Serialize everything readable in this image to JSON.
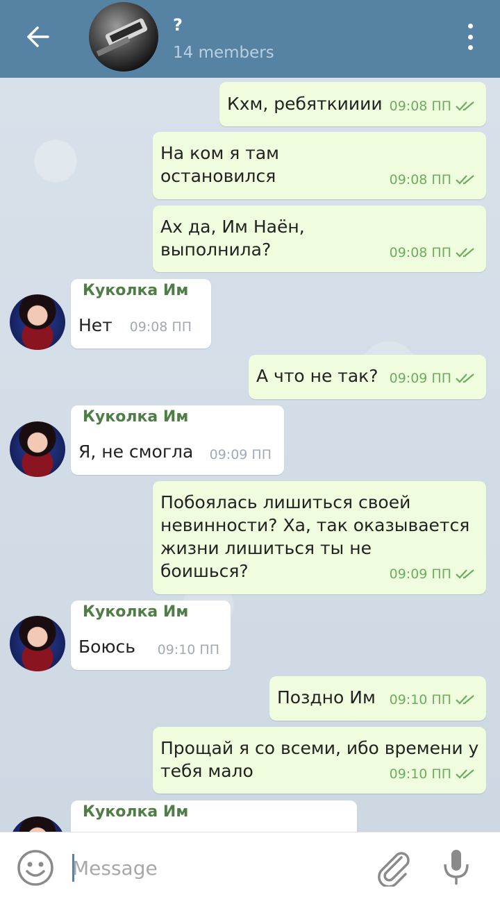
{
  "header": {
    "title": "?",
    "subtitle": "14 members",
    "icons": {
      "back": "arrow-left-icon",
      "menu": "more-vertical-icon"
    }
  },
  "messages": [
    {
      "type": "out",
      "text": "Кхм, ребяткииии",
      "time": "09:08 ПП"
    },
    {
      "type": "out",
      "text": "На ком я там\nостановился",
      "time": "09:08 ПП"
    },
    {
      "type": "out",
      "text": "Ах да, Им Наён,\nвыполнила?",
      "time": "09:08 ПП"
    },
    {
      "type": "in",
      "sender": "Куколка Им",
      "text": "Нет",
      "time": "09:08 ПП"
    },
    {
      "type": "out",
      "text": "А что не так?",
      "time": "09:09 ПП"
    },
    {
      "type": "in",
      "sender": "Куколка Им",
      "text": "Я, не смогла",
      "time": "09:09 ПП"
    },
    {
      "type": "out",
      "text": "Побоялась лишиться своей\nневинности? Ха, так оказывается\nжизни лишиться ты не\nбоишься?",
      "time": "09:09 ПП"
    },
    {
      "type": "in",
      "sender": "Куколка Им",
      "text": "Боюсь",
      "time": "09:10 ПП"
    },
    {
      "type": "out",
      "text": "Поздно Им",
      "time": "09:10 ПП"
    },
    {
      "type": "out",
      "text": "Прощай я со всеми, ибо времени у\nтебя мало",
      "time": "09:10 ПП"
    },
    {
      "type": "in",
      "sender": "Куколка Им",
      "text": "",
      "time": ""
    }
  ],
  "composer": {
    "placeholder": "Message",
    "icons": {
      "emoji": "emoji-icon",
      "attach": "paperclip-icon",
      "mic": "microphone-icon"
    }
  },
  "colors": {
    "header_bg": "#5682a3",
    "outgoing_bubble": "#effdde",
    "incoming_bubble": "#ffffff",
    "sender_name": "#4e7d45",
    "read_checks": "#6cad5d"
  }
}
